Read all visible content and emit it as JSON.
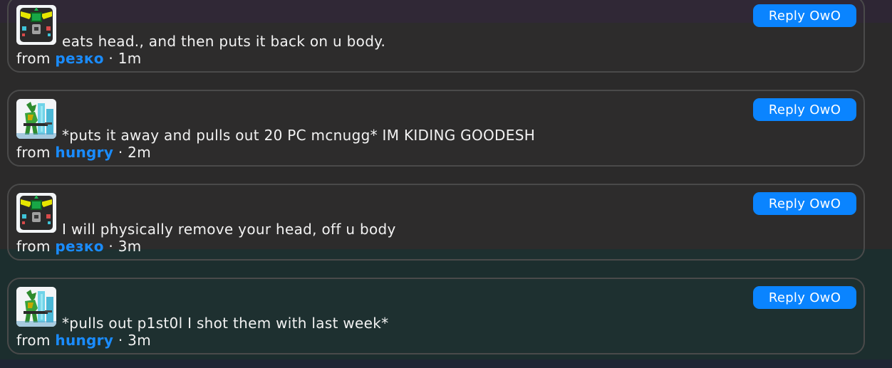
{
  "posts": [
    {
      "text": "eats head., and then puts it back on u body.",
      "from_label": "from",
      "username": "резко",
      "separator": "·",
      "age": "1m",
      "reply_label": "Reply OwO",
      "avatar_icon": "robot-face-avatar-icon"
    },
    {
      "text": "*puts it away and pulls out 20 PC mcnugg* IM KIDING GOODESH",
      "from_label": "from",
      "username": "hungry",
      "separator": "·",
      "age": "2m",
      "reply_label": "Reply OwO",
      "avatar_icon": "dragon-soldier-avatar-icon"
    },
    {
      "text": "I will physically remove your head, off u body",
      "from_label": "from",
      "username": "резко",
      "separator": "·",
      "age": "3m",
      "reply_label": "Reply OwO",
      "avatar_icon": "robot-face-avatar-icon"
    },
    {
      "text": "*pulls out p1st0l I shot them with last week*",
      "from_label": "from",
      "username": "hungry",
      "separator": "·",
      "age": "3m",
      "reply_label": "Reply OwO",
      "avatar_icon": "dragon-soldier-avatar-icon"
    }
  ],
  "colors": {
    "accent": "#0a84ff",
    "username": "#1a8cff",
    "card_border": "#4a4a4a"
  }
}
